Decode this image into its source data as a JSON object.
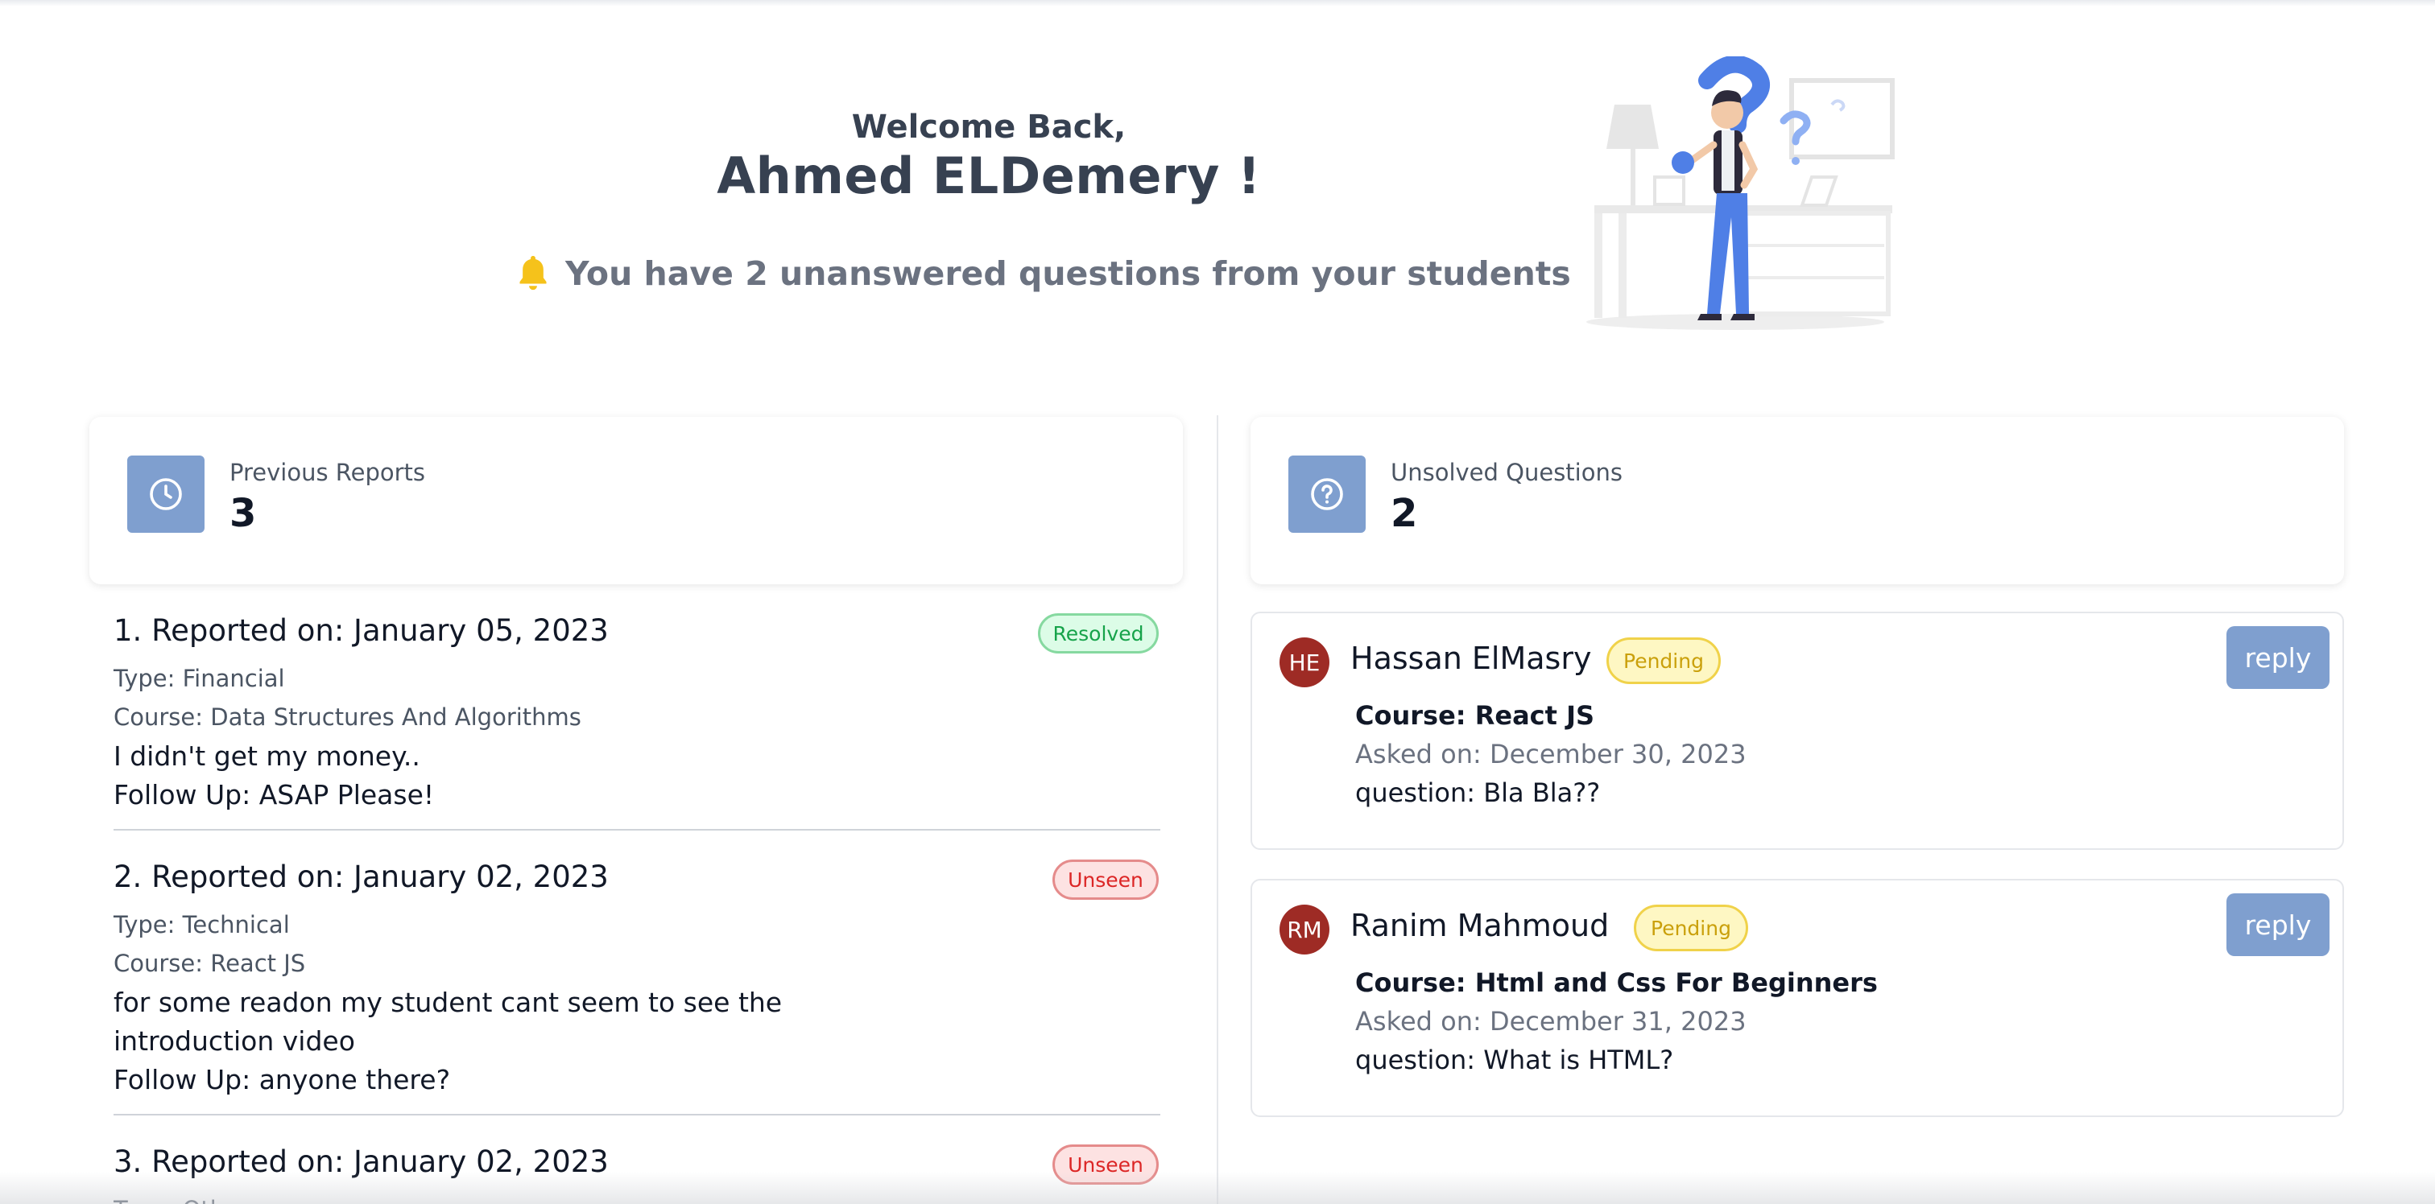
{
  "header": {
    "greeting": "Welcome Back,",
    "name": "Ahmed ELDemery !",
    "notice": "You have 2 unanswered questions from your students"
  },
  "stats": {
    "reports": {
      "label": "Previous Reports",
      "value": "3",
      "icon": "clock-icon"
    },
    "questions": {
      "label": "Unsolved Questions",
      "value": "2",
      "icon": "question-circle-icon"
    }
  },
  "reports": [
    {
      "title": "1. Reported on: January 05, 2023",
      "status": "Resolved",
      "type": "Type: Financial",
      "course": "Course: Data Structures And Algorithms",
      "message": "I didn't get my money..",
      "followup": "Follow Up: ASAP Please!"
    },
    {
      "title": "2. Reported on: January 02, 2023",
      "status": "Unseen",
      "type": "Type: Technical",
      "course": "Course: React JS",
      "message": "for some readon my student cant seem to see the introduction video",
      "followup": "Follow Up: anyone there?"
    },
    {
      "title": "3. Reported on: January 02, 2023",
      "status": "Unseen",
      "type": "Type: Oth"
    }
  ],
  "questions": [
    {
      "initials": "HE",
      "name": "Hassan ElMasry",
      "status": "Pending",
      "reply": "reply",
      "course": "Course: React JS",
      "asked": "Asked on: December 30, 2023",
      "question": "question: Bla Bla??"
    },
    {
      "initials": "RM",
      "name": "Ranim Mahmoud",
      "status": "Pending",
      "reply": "reply",
      "course": "Course: Html and Css For Beginners",
      "asked": "Asked on: December 31, 2023",
      "question": "question: What is HTML?"
    }
  ],
  "colors": {
    "accent": "#7f9fcf",
    "resolved": "#16a34a",
    "unseen": "#dc2626",
    "pending": "#caa00c",
    "avatar": "#9e2b25",
    "bell": "#f5c21b"
  }
}
